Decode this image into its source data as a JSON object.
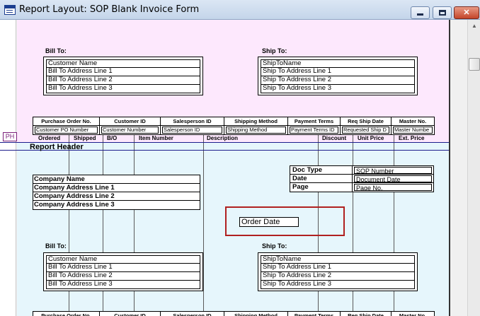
{
  "window": {
    "title": "Report Layout: SOP Blank Invoice Form",
    "close_glyph": "✕"
  },
  "bands": {
    "page_header_tag": "PH",
    "report_header_label": "Report Header"
  },
  "bill_to": {
    "label": "Bill To:",
    "lines": [
      "Customer Name",
      "Bill To Address Line 1",
      "Bill To Address Line 2",
      "Bill To Address Line 3"
    ]
  },
  "ship_to": {
    "label": "Ship To:",
    "lines": [
      "ShipToName",
      "Ship To Address Line 1",
      "Ship To Address Line 2",
      "Ship To Address Line 3"
    ]
  },
  "order_grid": {
    "headers": [
      "Purchase Order No.",
      "Customer ID",
      "Salesperson ID",
      "Shipping Method",
      "Payment Terms",
      "Req Ship Date",
      "Master No."
    ],
    "values": [
      "Customer PO Number",
      "Customer Number",
      "Salesperson ID",
      "Shipping Method",
      "Payment Terms ID",
      "Requested Ship D",
      "Master Numbe"
    ]
  },
  "line_columns": [
    "Ordered",
    "Shipped",
    "B/O",
    "Item Number",
    "Description",
    "Discount",
    "Unit Price",
    "Ext. Price"
  ],
  "company": [
    "Company Name",
    "Company Address Line 1",
    "Company Address Line 2",
    "Company Address Line 3"
  ],
  "doc_info": [
    {
      "key": "Doc Type",
      "value": "SOP Number"
    },
    {
      "key": "Date",
      "value": "Document Date"
    },
    {
      "key": "Page",
      "value": "Page No."
    }
  ],
  "order_date_field": "Order Date",
  "colors": {
    "page_header_band": "#fde8fd",
    "report_header_band": "#e6f6fc",
    "selection": "#b02020",
    "band_divider": "#1c1c8c"
  },
  "icons": {
    "app": "report-layout-icon",
    "scroll_up": "▲"
  }
}
